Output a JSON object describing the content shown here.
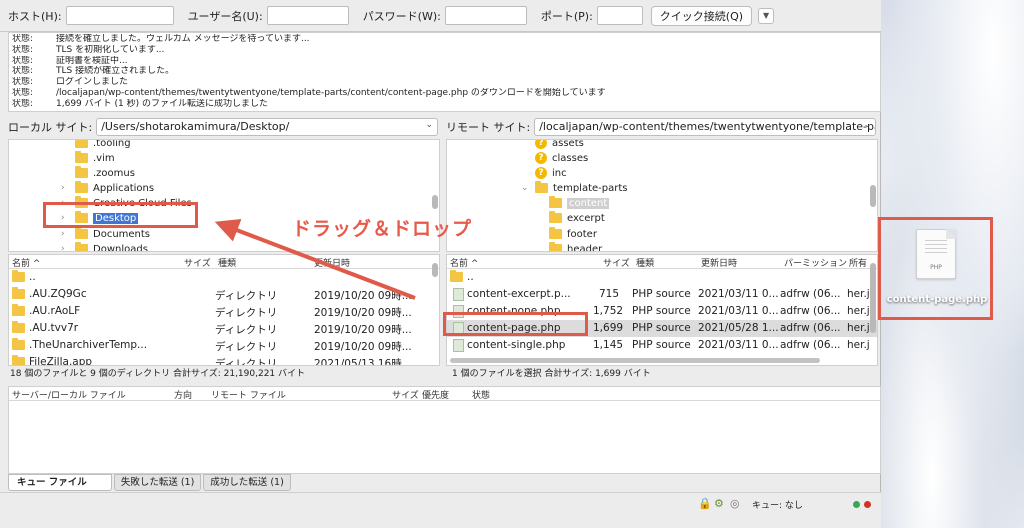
{
  "quickconnect": {
    "host_label": "ホスト(H):",
    "user_label": "ユーザー名(U):",
    "password_label": "パスワード(W):",
    "port_label": "ポート(P):",
    "connect_label": "クイック接続(Q)",
    "host_value": "",
    "user_value": "",
    "password_value": "",
    "port_value": ""
  },
  "log": [
    {
      "k": "状態:",
      "v": "接続を確立しました。ウェルカム メッセージを待っています..."
    },
    {
      "k": "状態:",
      "v": "TLS を初期化しています..."
    },
    {
      "k": "状態:",
      "v": "証明書を検証中..."
    },
    {
      "k": "状態:",
      "v": "TLS 接続が確立されました。"
    },
    {
      "k": "状態:",
      "v": "ログインしました"
    },
    {
      "k": "状態:",
      "v": "/localjapan/wp-content/themes/twentytwentyone/template-parts/content/content-page.php のダウンロードを開始しています"
    },
    {
      "k": "状態:",
      "v": "1,699 バイト (1 秒) のファイル転送に成功しました"
    }
  ],
  "local": {
    "site_label": "ローカル サイト:",
    "path": "/Users/shotarokamimura/Desktop/",
    "tree": [
      {
        "label": ".tooling",
        "chev": ""
      },
      {
        "label": ".vim",
        "chev": ""
      },
      {
        "label": ".zoomus",
        "chev": ""
      },
      {
        "label": "Applications",
        "chev": "›"
      },
      {
        "label": "Creative Cloud Files",
        "chev": "›"
      },
      {
        "label": "Desktop",
        "chev": "›"
      },
      {
        "label": "Documents",
        "chev": "›"
      },
      {
        "label": "Downloads",
        "chev": "›"
      }
    ],
    "headers": {
      "name": "名前 ^",
      "size": "サイズ",
      "type": "種類",
      "modified": "更新日時"
    },
    "files": [
      {
        "name": "..",
        "size": "",
        "type": "",
        "modified": ""
      },
      {
        "name": ".AU.ZQ9Gc",
        "size": "",
        "type": "ディレクトリ",
        "modified": "2019/10/20 09時..."
      },
      {
        "name": ".AU.rAoLF",
        "size": "",
        "type": "ディレクトリ",
        "modified": "2019/10/20 09時..."
      },
      {
        "name": ".AU.tvv7r",
        "size": "",
        "type": "ディレクトリ",
        "modified": "2019/10/20 09時..."
      },
      {
        "name": ".TheUnarchiverTemp...",
        "size": "",
        "type": "ディレクトリ",
        "modified": "2019/10/20 09時..."
      },
      {
        "name": "FileZilla.app",
        "size": "",
        "type": "ディレクトリ",
        "modified": "2021/05/13 16時..."
      }
    ],
    "status": "18 個のファイルと 9 個のディレクトリ 合計サイズ: 21,190,221 バイト"
  },
  "remote": {
    "site_label": "リモート サイト:",
    "path": "/localjapan/wp-content/themes/twentytwentyone/template-parts/c",
    "tree": [
      {
        "label": "assets",
        "icon": "q",
        "chev": ""
      },
      {
        "label": "classes",
        "icon": "q",
        "chev": ""
      },
      {
        "label": "inc",
        "icon": "q",
        "chev": ""
      },
      {
        "label": "template-parts",
        "icon": "folder",
        "chev": "⌄"
      },
      {
        "label": "content",
        "icon": "folder",
        "chev": ""
      },
      {
        "label": "excerpt",
        "icon": "folder",
        "chev": ""
      },
      {
        "label": "footer",
        "icon": "folder",
        "chev": ""
      },
      {
        "label": "header",
        "icon": "folder",
        "chev": ""
      }
    ],
    "headers": {
      "name": "名前 ^",
      "size": "サイズ",
      "type": "種類",
      "modified": "更新日時",
      "perm": "パーミッション",
      "owner": "所有"
    },
    "files": [
      {
        "name": "..",
        "size": "",
        "type": "",
        "modified": "",
        "perm": "",
        "owner": ""
      },
      {
        "name": "content-excerpt.p...",
        "size": "715",
        "type": "PHP source",
        "modified": "2021/03/11 0...",
        "perm": "adfrw (06...",
        "owner": "her.j"
      },
      {
        "name": "content-none.php",
        "size": "1,752",
        "type": "PHP source",
        "modified": "2021/03/11 0...",
        "perm": "adfrw (06...",
        "owner": "her.j"
      },
      {
        "name": "content-page.php",
        "size": "1,699",
        "type": "PHP source",
        "modified": "2021/05/28 1...",
        "perm": "adfrw (06...",
        "owner": "her.j"
      },
      {
        "name": "content-single.php",
        "size": "1,145",
        "type": "PHP source",
        "modified": "2021/03/11 0...",
        "perm": "adfrw (06...",
        "owner": "her.j"
      }
    ],
    "status": "1 個のファイルを選択 合計サイズ: 1,699 バイト"
  },
  "queue": {
    "headers": {
      "server": "サーバー/ローカル ファイル",
      "dir": "方向",
      "remote": "リモート ファイル",
      "size": "サイズ",
      "priority": "優先度",
      "status": "状態"
    },
    "tabs": [
      "キュー ファイル",
      "失敗した転送 (1)",
      "成功した転送 (1)"
    ],
    "queue_status": "キュー: なし"
  },
  "annotation": {
    "label": "ドラッグ＆ドロップ",
    "color": "#e05a4b"
  },
  "desktop": {
    "file_name": "content-page.php",
    "file_ext": "PHP"
  }
}
